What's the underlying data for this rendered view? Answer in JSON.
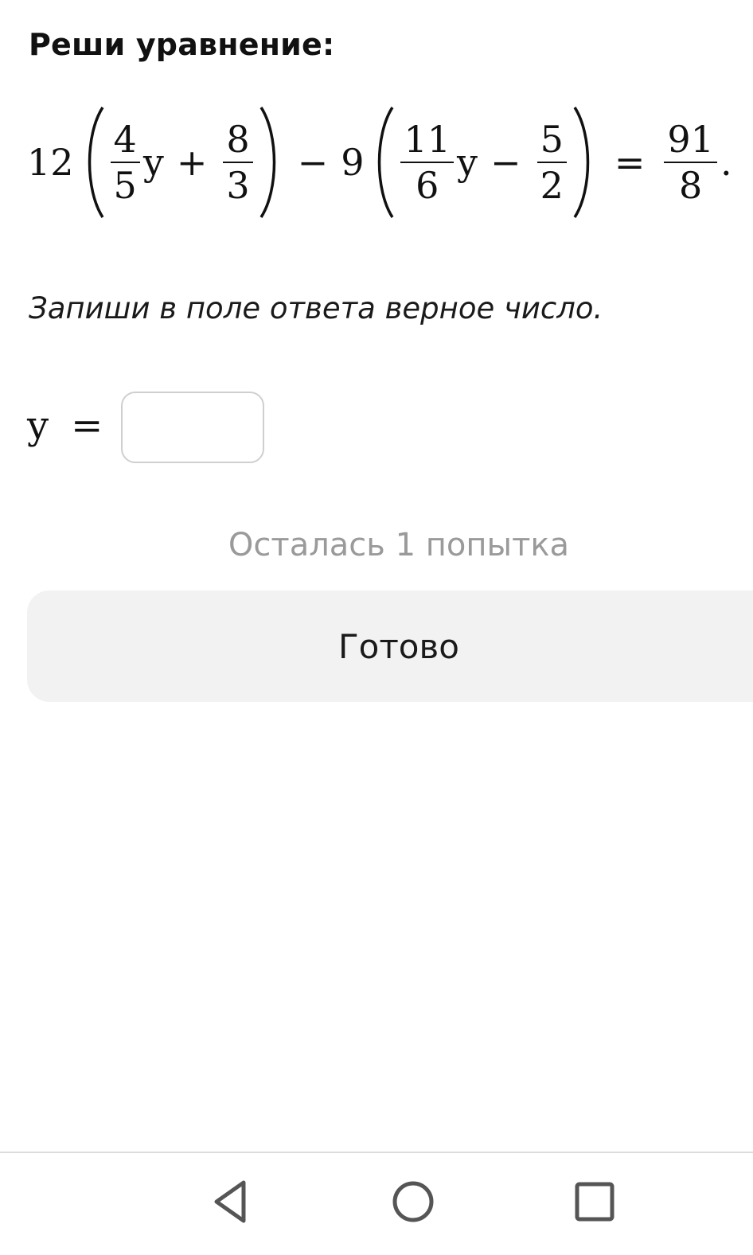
{
  "task": {
    "title": "Реши уравнение:"
  },
  "equation": {
    "coef1": "12",
    "frac1": {
      "num": "4",
      "den": "5"
    },
    "var1": "y",
    "op1": "+",
    "frac2": {
      "num": "8",
      "den": "3"
    },
    "op2": "−",
    "coef2": "9",
    "frac3": {
      "num": "11",
      "den": "6"
    },
    "var2": "y",
    "op3": "−",
    "frac4": {
      "num": "5",
      "den": "2"
    },
    "eq": "=",
    "frac5": {
      "num": "91",
      "den": "8"
    },
    "period": "."
  },
  "instruction": "Запиши в поле ответа верное число.",
  "answer": {
    "variable": "y",
    "eq": "=",
    "value": "",
    "placeholder": ""
  },
  "attempts_text": "Осталась 1 попытка",
  "done_button": "Готово",
  "nav_bar": {
    "back_icon": "triangle-back-icon",
    "home_icon": "circle-home-icon",
    "recent_icon": "square-recent-apps-icon"
  }
}
